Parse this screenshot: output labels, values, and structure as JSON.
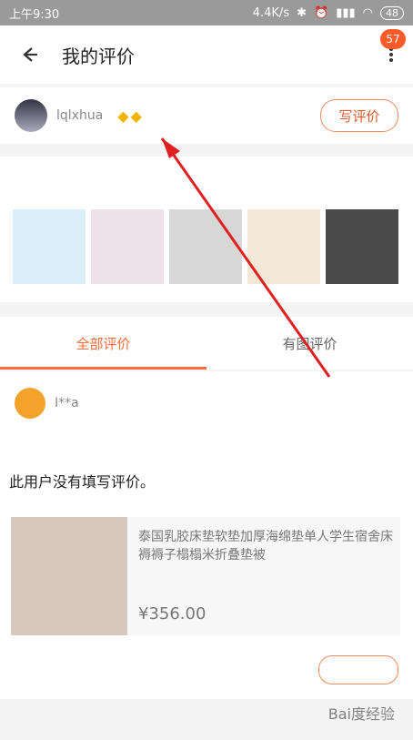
{
  "status": {
    "time": "上午9:30",
    "speed": "4.4K/s",
    "battery": "48"
  },
  "header": {
    "title": "我的评价",
    "badge": "57"
  },
  "user": {
    "name": "lqlxhua",
    "write_review": "写评价"
  },
  "tabs": [
    {
      "label": "全部评价"
    },
    {
      "label": "有图评价"
    }
  ],
  "review": {
    "name": "I**a",
    "text": "此用户没有填写评价。",
    "product_title": "泰国乳胶床垫软垫加厚海绵垫单人学生宿舍床褥褥子榻榻米折叠垫被",
    "price": "¥356.00"
  },
  "watermark": "Bai度经验"
}
